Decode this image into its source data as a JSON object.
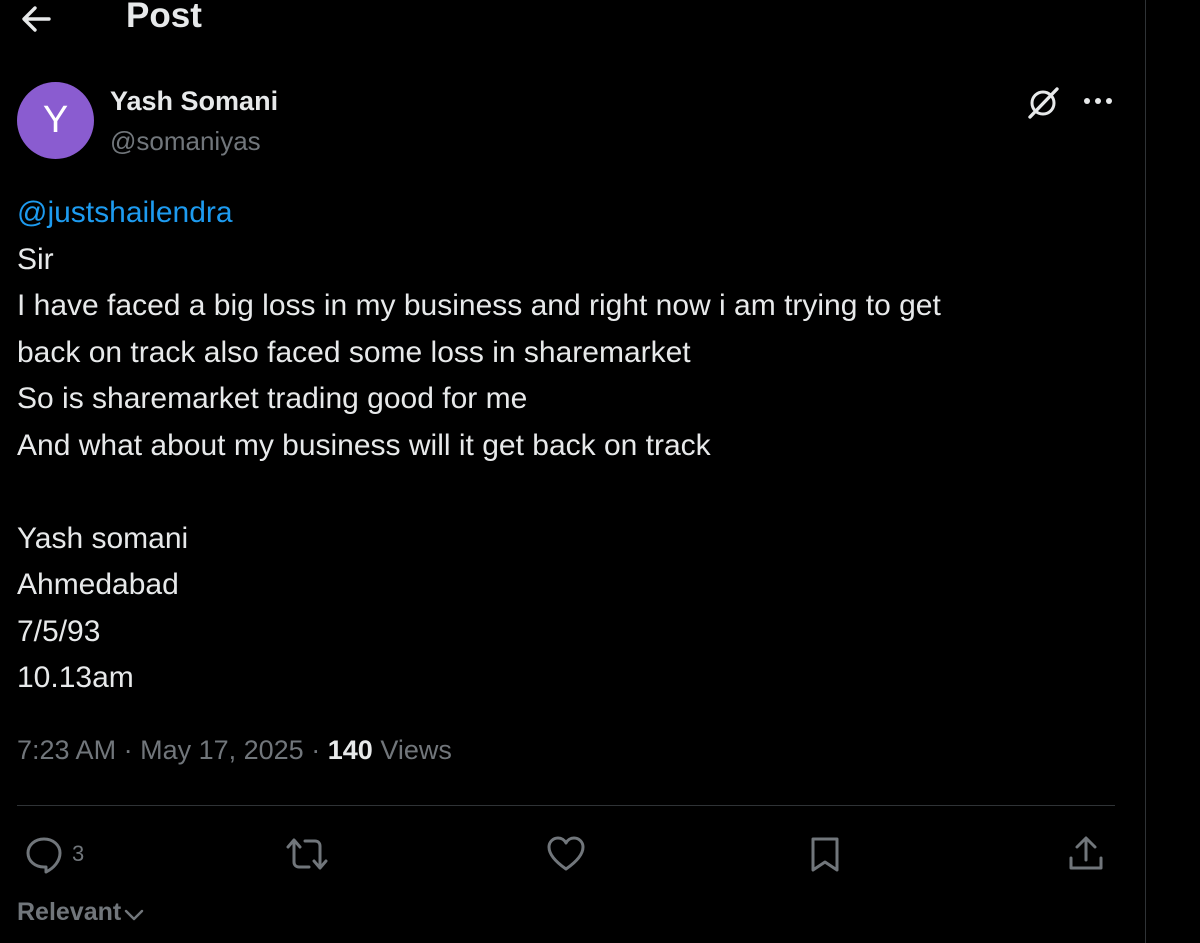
{
  "header": {
    "back_icon": "arrow-left-icon",
    "title": "Post"
  },
  "author": {
    "avatar_letter": "Y",
    "avatar_color": "#8a5cd0",
    "display_name": "Yash Somani",
    "handle": "@somaniyas"
  },
  "post": {
    "mention": "@justshailendra",
    "lines": [
      "Sir",
      "I have faced a big loss in my business and right now i am trying to get",
      "back on track also faced some loss in sharemarket",
      "So is sharemarket trading good for me",
      "And what about my business will it get back on track",
      "",
      "Yash somani",
      "Ahmedabad",
      "7/5/93",
      "10.13am"
    ]
  },
  "meta": {
    "time": "7:23 AM",
    "separator": "·",
    "date": "May 17, 2025",
    "views_count": "140",
    "views_label": "Views"
  },
  "actions": {
    "reply_count": "3",
    "icons": [
      "reply-icon",
      "repost-icon",
      "like-icon",
      "bookmark-icon",
      "share-icon"
    ]
  },
  "sort": {
    "label": "Relevant",
    "icon": "chevron-down-icon"
  },
  "colors": {
    "background": "#000000",
    "text": "#e7e9ea",
    "muted": "#71767b",
    "link": "#1d9bf0",
    "border": "#2f3336"
  }
}
